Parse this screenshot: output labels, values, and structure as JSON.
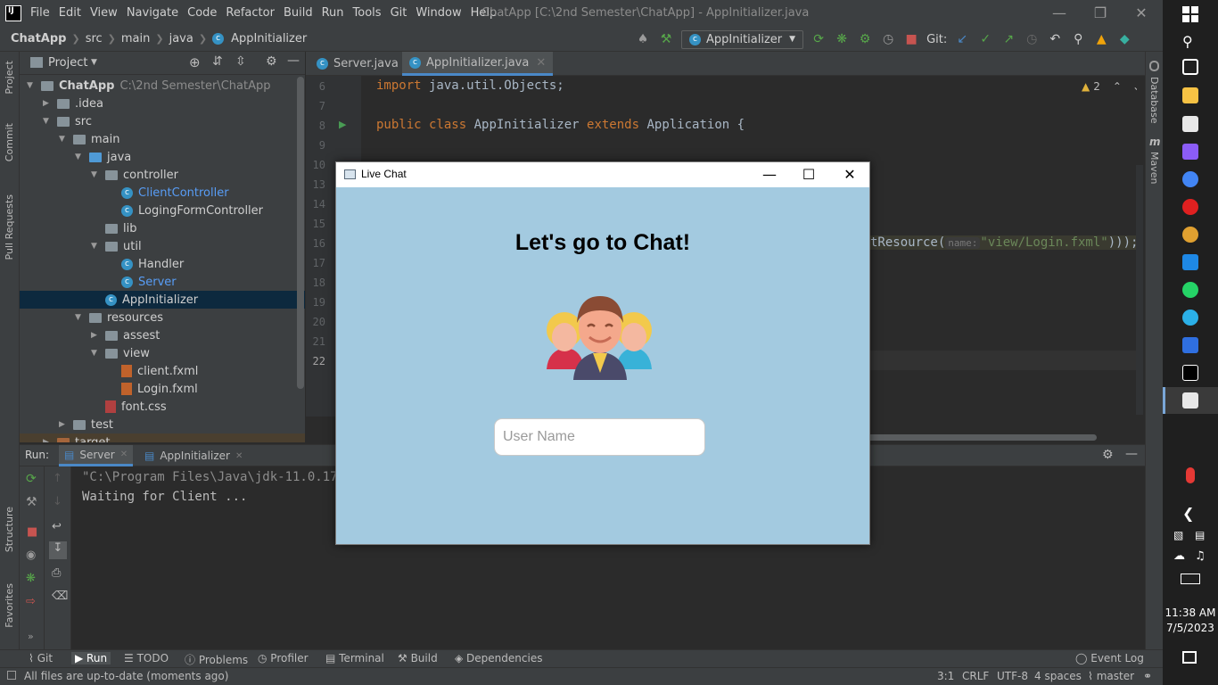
{
  "titlebar": {
    "logo_text": "IJ",
    "menu": [
      "File",
      "Edit",
      "View",
      "Navigate",
      "Code",
      "Refactor",
      "Build",
      "Run",
      "Tools",
      "Git",
      "Window",
      "Help"
    ],
    "window_title": "ChatApp [C:\\2nd Semester\\ChatApp] - AppInitializer.java"
  },
  "breadcrumb": [
    "ChatApp",
    "src",
    "main",
    "java",
    "AppInitializer"
  ],
  "toolbar": {
    "run_config": "AppInitializer",
    "git_label": "Git:"
  },
  "left_strip": [
    "Project",
    "Commit",
    "Pull Requests",
    "Structure",
    "Favorites"
  ],
  "project_panel": {
    "title": "Project",
    "tree": [
      {
        "label": "ChatApp",
        "path": "C:\\2nd Semester\\ChatApp"
      },
      {
        "label": ".idea"
      },
      {
        "label": "src"
      },
      {
        "label": "main"
      },
      {
        "label": "java"
      },
      {
        "label": "controller"
      },
      {
        "label": "ClientController"
      },
      {
        "label": "LogingFormController"
      },
      {
        "label": "lib"
      },
      {
        "label": "util"
      },
      {
        "label": "Handler"
      },
      {
        "label": "Server"
      },
      {
        "label": "AppInitializer"
      },
      {
        "label": "resources"
      },
      {
        "label": "assest"
      },
      {
        "label": "view"
      },
      {
        "label": "client.fxml"
      },
      {
        "label": "Login.fxml"
      },
      {
        "label": "font.css"
      },
      {
        "label": "test"
      },
      {
        "label": "target"
      }
    ]
  },
  "editor": {
    "tabs": [
      "Server.java",
      "AppInitializer.java"
    ],
    "line_numbers": [
      "6",
      "7",
      "8",
      "9",
      "10",
      "13",
      "14",
      "15",
      "16",
      "17",
      "18",
      "19",
      "20",
      "21",
      "22"
    ],
    "code": {
      "l6_kw": "import",
      "l6_rest": " java.util.Objects;",
      "l8_kw1": "public class",
      "l8_name": " AppInitializer ",
      "l8_kw2": "extends",
      "l8_rest": " Application {",
      "l16_pre": "tResource(",
      "l16_hint": "name:",
      "l16_str": "\"view/Login.fxml\"",
      "l16_post": ")));"
    },
    "warnings": "2"
  },
  "right_strip": [
    "Database",
    "Maven"
  ],
  "run_panel": {
    "label": "Run:",
    "tabs": [
      "Server",
      "AppInitializer"
    ],
    "console": [
      "\"C:\\Program Files\\Java\\jdk-11.0.17\\b",
      "Waiting for Client ..."
    ]
  },
  "bottom_tools": [
    "Git",
    "Run",
    "TODO",
    "Problems",
    "Profiler",
    "Terminal",
    "Build",
    "Dependencies",
    "Event Log"
  ],
  "status": {
    "message": "All files are up-to-date (moments ago)",
    "position": "3:1",
    "line_sep": "CRLF",
    "encoding": "UTF-8",
    "indent": "4 spaces",
    "branch": "master"
  },
  "taskbar": {
    "time": "11:38 AM",
    "date": "7/5/2023"
  },
  "live_chat": {
    "title": "Live Chat",
    "heading": "Let's go to Chat!",
    "input_placeholder": "User Name",
    "input_value": ""
  },
  "colors": {
    "ide_bg": "#2b2b2b",
    "panel_bg": "#3c3f41",
    "chat_bg": "#a3cae0",
    "accent": "#4a88c7"
  }
}
